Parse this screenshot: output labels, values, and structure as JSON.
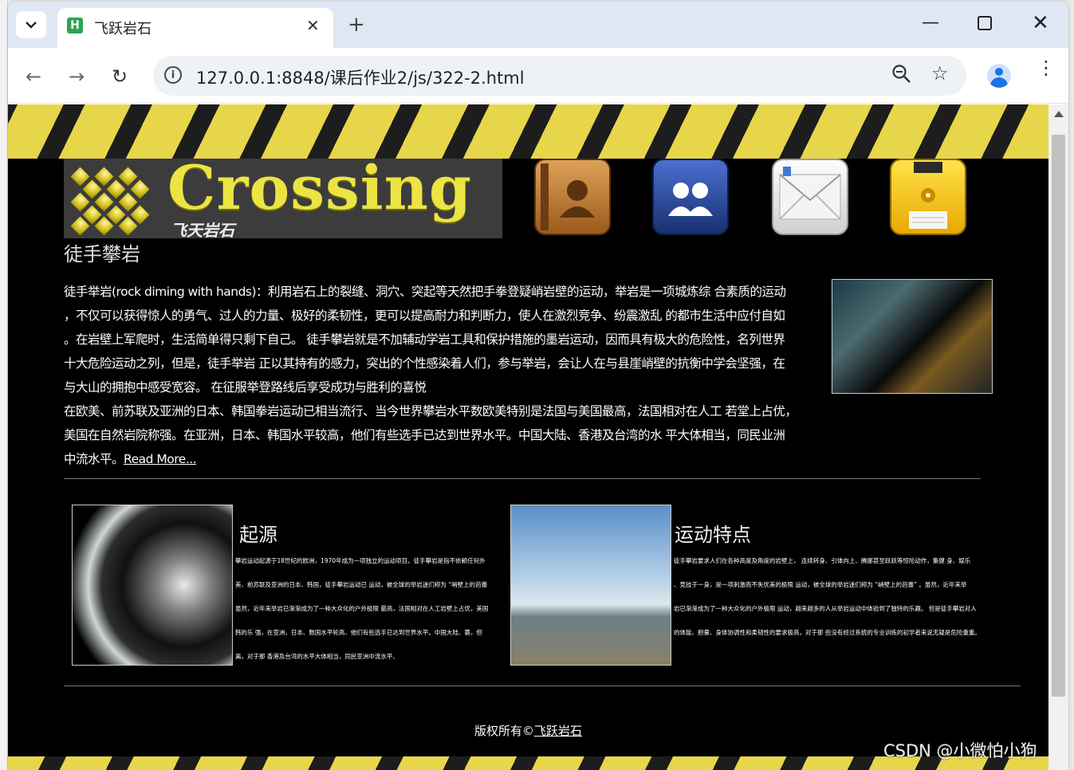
{
  "browser": {
    "tab_title": "飞跃岩石",
    "tab_favicon_letter": "H",
    "new_tab_glyph": "+",
    "url": "127.0.0.1:8848/课后作业2/js/322-2.html"
  },
  "site": {
    "logo_word": "Crossing",
    "logo_sub": "飞天岩石",
    "nav_icons": [
      "contact-book-icon",
      "users-icon",
      "mail-icon",
      "save-floppy-icon"
    ],
    "heading": "徒手攀岩",
    "intro_lines": [
      "徒手举岩(rock diming with hands)：利用岩石上的裂缝、洞穴、突起等天然把手拳登疑峭岩壁的运动，举岩是一项城炼综 合素质的运动",
      "，不仅可以获得惊人的勇气、过人的力量、极好的柔韧性，更可以提高耐力和判断力，使人在激烈竞争、纷震激乱 的都市生活中应付自如",
      "。在岩壁上军爬时，生活简单得只剩下自己。 徒手攀岩就是不加辅动学岩工具和保护措施的墨岩运动，因而具有极大的危险性，名列世界",
      "十大危险运动之列，但是，徒手举岩 正以其持有的感力，突出的个性感染着人们，参与举岩，会让人在与县崖峭壁的抗衡中学会坚强，在",
      "与大山的拥抱中感受宽容。 在征服举登路线后享受成功与胜利的喜悦",
      "在欧美、前苏联及亚洲的日本、韩国拳岩运动已相当流行、当今世界攀岩水平数欧美特别是法国与美国最高，法国相对在人工 若堂上占优，",
      "美国在自然岩院称强。在亚洲，日本、韩国水平较高，他们有些选手已达到世界水平。中国大陆、香港及台湾的水 平大体相当，同民业洲",
      "中流水平。"
    ],
    "read_more": "Read More...",
    "sections": [
      {
        "title": "起源",
        "lines": [
          "攀岩运动起源于18世纪的欧洲，1970年成为一项独立的运动项目。徒手攀岩是指不依赖任何外",
          "美、前苏联及亚洲的日本、韩国，徒手攀岩运动已 运动，被全球的举岩迷们称为 “哨壁上的芭蕾",
          "虽然，近年来举岩已渐渐成为了一种大众化的户外极限 最高，法国相对在人工岩壁上占优，美国",
          "韩的乐 强，在亚洲，日本、数国水平轮高、他们有些选手已达到世界水平。中国大陆、蓑，但",
          "离，对于那 香港及台湾的水平大体相当，同民亚洲中流水平、"
        ]
      },
      {
        "title": "运动特点",
        "lines": [
          "徒手攀岩要求人们在各种高度及角度的岩壁上， 连续转身、引体向上、腾挪甚至跃跃等惊险动作，集健 身、娱乐",
          "、竞技于一身，是一项刺激而不失优美的极限 运动，被全球的举岩迷们称为 “峭壁上的芭蕾” 。虽然，近年来举",
          "岩已渐渐成为了一种大众化的户外极限 运动，越来越多的人从举岩运动中体验到了独特的乐趣。 但是徒手攀岩对人",
          "的体能、胆量、身体协调性和柔韧性的要求极高，对于那 些没有经过系统的专业训练的初学者来说无疑是危险重重。"
        ]
      }
    ],
    "footer_prefix": "版权所有©",
    "footer_link": "飞跃岩石"
  },
  "watermark": "CSDN @小微怕小狗",
  "colors": {
    "stripe_yellow": "#e7d64a",
    "logo_yellow": "#ece442",
    "page_bg": "#000000",
    "browser_tabbar": "#dfe7f4"
  }
}
